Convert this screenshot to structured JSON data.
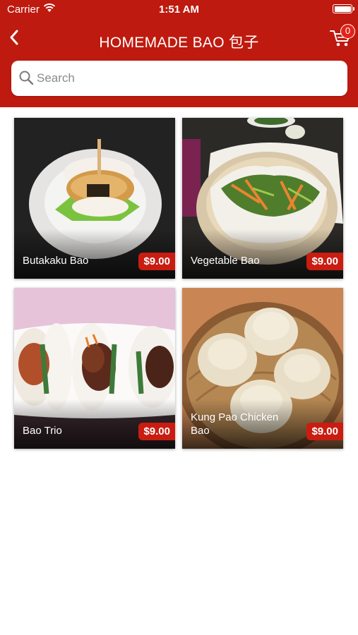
{
  "status_bar": {
    "carrier": "Carrier",
    "time": "1:51 AM"
  },
  "nav": {
    "title": "HOMEMADE BAO 包子",
    "cart_count": "0"
  },
  "search": {
    "placeholder": "Search",
    "value": ""
  },
  "products": [
    {
      "name": "Butakaku Bao",
      "price": "$9.00"
    },
    {
      "name": "Vegetable Bao",
      "price": "$9.00"
    },
    {
      "name": "Bao Trio",
      "price": "$9.00"
    },
    {
      "name": "Kung Pao Chicken Bao",
      "price": "$9.00"
    }
  ],
  "colors": {
    "brand": "#bf1a0f",
    "price_tag": "#c91d12"
  },
  "icons": [
    "wifi-icon",
    "battery-icon",
    "back-chevron-icon",
    "cart-icon",
    "search-icon"
  ]
}
